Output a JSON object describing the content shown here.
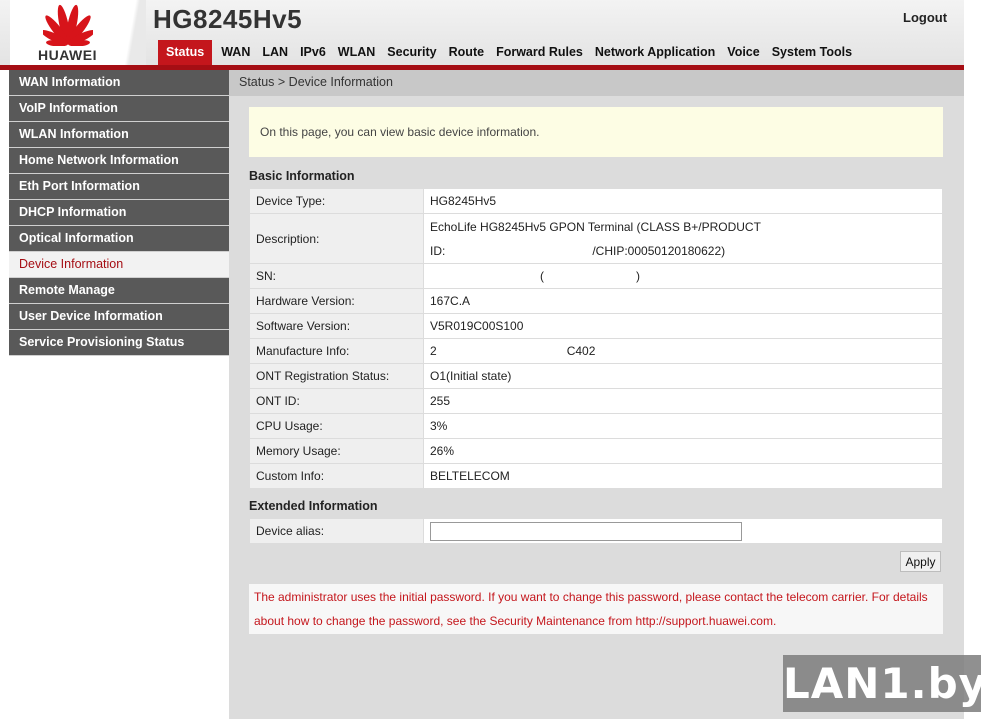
{
  "brand": {
    "logo_text": "HUAWEI",
    "model": "HG8245Hv5"
  },
  "header": {
    "logout_label": "Logout"
  },
  "nav": {
    "items": [
      {
        "label": "Status"
      },
      {
        "label": "WAN"
      },
      {
        "label": "LAN"
      },
      {
        "label": "IPv6"
      },
      {
        "label": "WLAN"
      },
      {
        "label": "Security"
      },
      {
        "label": "Route"
      },
      {
        "label": "Forward Rules"
      },
      {
        "label": "Network Application"
      },
      {
        "label": "Voice"
      },
      {
        "label": "System Tools"
      }
    ],
    "active": "Status"
  },
  "sidebar": {
    "items": [
      {
        "label": "WAN Information"
      },
      {
        "label": "VoIP Information"
      },
      {
        "label": "WLAN Information"
      },
      {
        "label": "Home Network Information"
      },
      {
        "label": "Eth Port Information"
      },
      {
        "label": "DHCP Information"
      },
      {
        "label": "Optical Information"
      },
      {
        "label": "Device Information"
      },
      {
        "label": "Remote Manage"
      },
      {
        "label": "User Device Information"
      },
      {
        "label": "Service Provisioning Status"
      }
    ],
    "active": "Device Information"
  },
  "main": {
    "breadcrumb": "Status > Device Information",
    "notice": "On this page, you can view basic device information.",
    "basic_title": "Basic Information",
    "basic": {
      "device_type": {
        "label": "Device Type:",
        "value": "HG8245Hv5"
      },
      "description": {
        "label": "Description:",
        "line1": "EchoLife HG8245Hv5 GPON Terminal (CLASS B+/PRODUCT",
        "line2_prefix": "ID:",
        "line2_suffix": "/CHIP:00050120180622)"
      },
      "sn": {
        "label": "SN:",
        "paren_open": "(",
        "paren_close": ")"
      },
      "hardware_version": {
        "label": "Hardware Version:",
        "value": "167C.A"
      },
      "software_version": {
        "label": "Software Version:",
        "value": "V5R019C00S100"
      },
      "manufacture_info": {
        "label": "Manufacture Info:",
        "prefix": "2",
        "suffix": "C402"
      },
      "ont_registration_status": {
        "label": "ONT Registration Status:",
        "value": "O1(Initial state)"
      },
      "ont_id": {
        "label": "ONT ID:",
        "value": "255"
      },
      "cpu_usage": {
        "label": "CPU Usage:",
        "value": "3%"
      },
      "memory_usage": {
        "label": "Memory Usage:",
        "value": "26%"
      },
      "custom_info": {
        "label": "Custom Info:",
        "value": "BELTELECOM"
      }
    },
    "extended_title": "Extended Information",
    "device_alias": {
      "label": "Device alias:",
      "value": "",
      "placeholder": ""
    },
    "apply_label": "Apply",
    "warning_line1": "The administrator uses the initial password. If you want to change this password, please contact the telecom carrier. For details",
    "warning_line2": "about how to change the password, see the Security Maintenance from http://support.huawei.com."
  },
  "watermark": "LAN1.by",
  "colors": {
    "brand_red": "#c4161c",
    "sidebar_bg": "#595959",
    "notice_bg": "#fdfde4"
  }
}
